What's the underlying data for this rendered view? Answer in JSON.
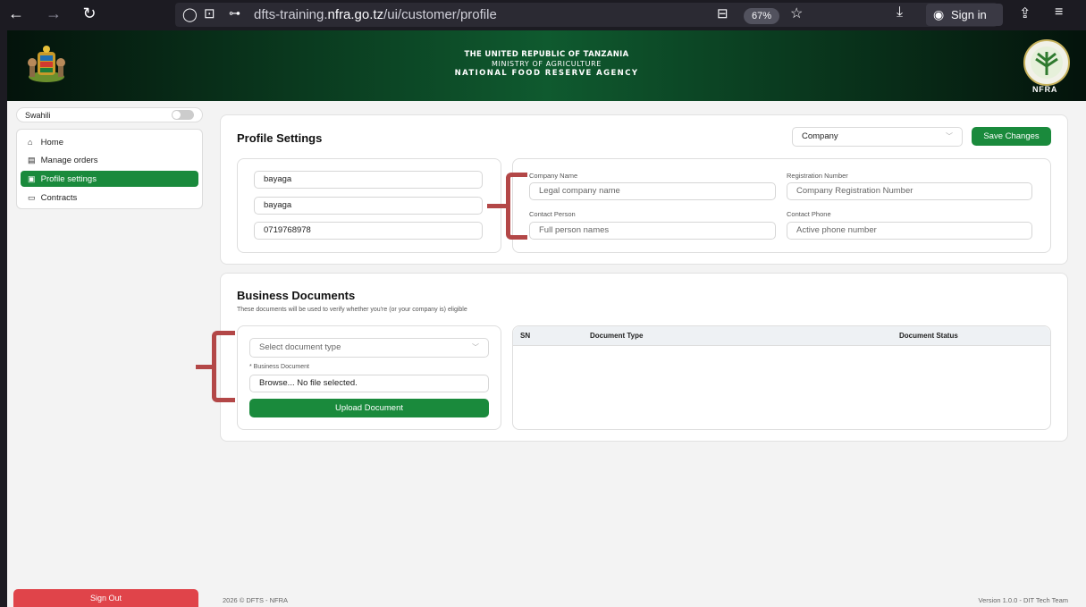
{
  "browser": {
    "url_prefix": "dfts-training.",
    "url_domain": "nfra.go.tz",
    "url_path": "/ui/customer/profile",
    "zoom": "67%",
    "sign_in": "Sign in"
  },
  "banner": {
    "line1": "THE UNITED REPUBLIC OF TANZANIA",
    "line2": "MINISTRY OF AGRICULTURE",
    "line3": "NATIONAL FOOD RESERVE AGENCY",
    "logo_text": "NFRA"
  },
  "sidebar": {
    "language_label": "Swahili",
    "items": [
      {
        "label": "Home",
        "icon": "home-icon",
        "glyph": "⌂"
      },
      {
        "label": "Manage orders",
        "icon": "orders-icon",
        "glyph": "▤"
      },
      {
        "label": "Profile settings",
        "icon": "profile-icon",
        "glyph": "▣"
      },
      {
        "label": "Contracts",
        "icon": "contracts-icon",
        "glyph": "▭"
      }
    ],
    "sign_out": "Sign Out"
  },
  "profile": {
    "title": "Profile Settings",
    "type_select": "Company",
    "save_label": "Save Changes",
    "personal_fields": [
      "bayaga",
      "bayaga",
      "0719768978"
    ],
    "company": {
      "company_name_label": "Company Name",
      "company_name_placeholder": "Legal company name",
      "registration_label": "Registration Number",
      "registration_placeholder": "Company Registration Number",
      "contact_person_label": "Contact Person",
      "contact_person_placeholder": "Full person names",
      "contact_phone_label": "Contact Phone",
      "contact_phone_placeholder": "Active phone number"
    }
  },
  "documents": {
    "title": "Business Documents",
    "subtitle": "These documents will be used to verify whether you're (or your company is) eligible",
    "doc_type_placeholder": "Select document type",
    "business_doc_label": "* Business Document",
    "file_input": "Browse... No file selected.",
    "upload_label": "Upload Document",
    "table_headers": [
      "SN",
      "Document Type",
      "Document Status"
    ]
  },
  "footer": {
    "left": "2026 © DFTS - NFRA",
    "right": "Version 1.0.0 - DIT Tech Team"
  },
  "colors": {
    "accent": "#1a8a3c",
    "danger": "#e0444a",
    "annotation": "#b34747"
  }
}
